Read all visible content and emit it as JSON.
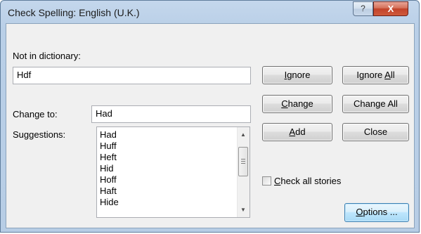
{
  "window": {
    "title": "Check Spelling: English (U.K.)",
    "help_glyph": "?",
    "close_glyph": "X"
  },
  "not_in_dictionary": {
    "label": "Not in dictionary:",
    "value": "Hdf"
  },
  "change_to": {
    "label": "Change to:",
    "value": "Had"
  },
  "suggestions": {
    "label": "Suggestions:",
    "items": [
      "Had",
      "Huff",
      "Heft",
      "Hid",
      "Hoff",
      "Haft",
      "Hide"
    ],
    "scroll_up_glyph": "▲",
    "scroll_down_glyph": "▼"
  },
  "buttons": {
    "ignore": {
      "pre": "",
      "key": "I",
      "post": "gnore"
    },
    "ignore_all": {
      "pre": "Ignore ",
      "key": "A",
      "post": "ll"
    },
    "change": {
      "pre": "",
      "key": "C",
      "post": "hange"
    },
    "change_all": {
      "pre": "Chan",
      "key": "g",
      "post": "e All"
    },
    "add": {
      "pre": "",
      "key": "A",
      "post": "dd"
    },
    "close": "Close",
    "options": {
      "pre": "",
      "key": "O",
      "post": "ptions ..."
    }
  },
  "check_all_stories": {
    "label_key": "C",
    "label_rest": "heck all stories",
    "checked": false
  }
}
